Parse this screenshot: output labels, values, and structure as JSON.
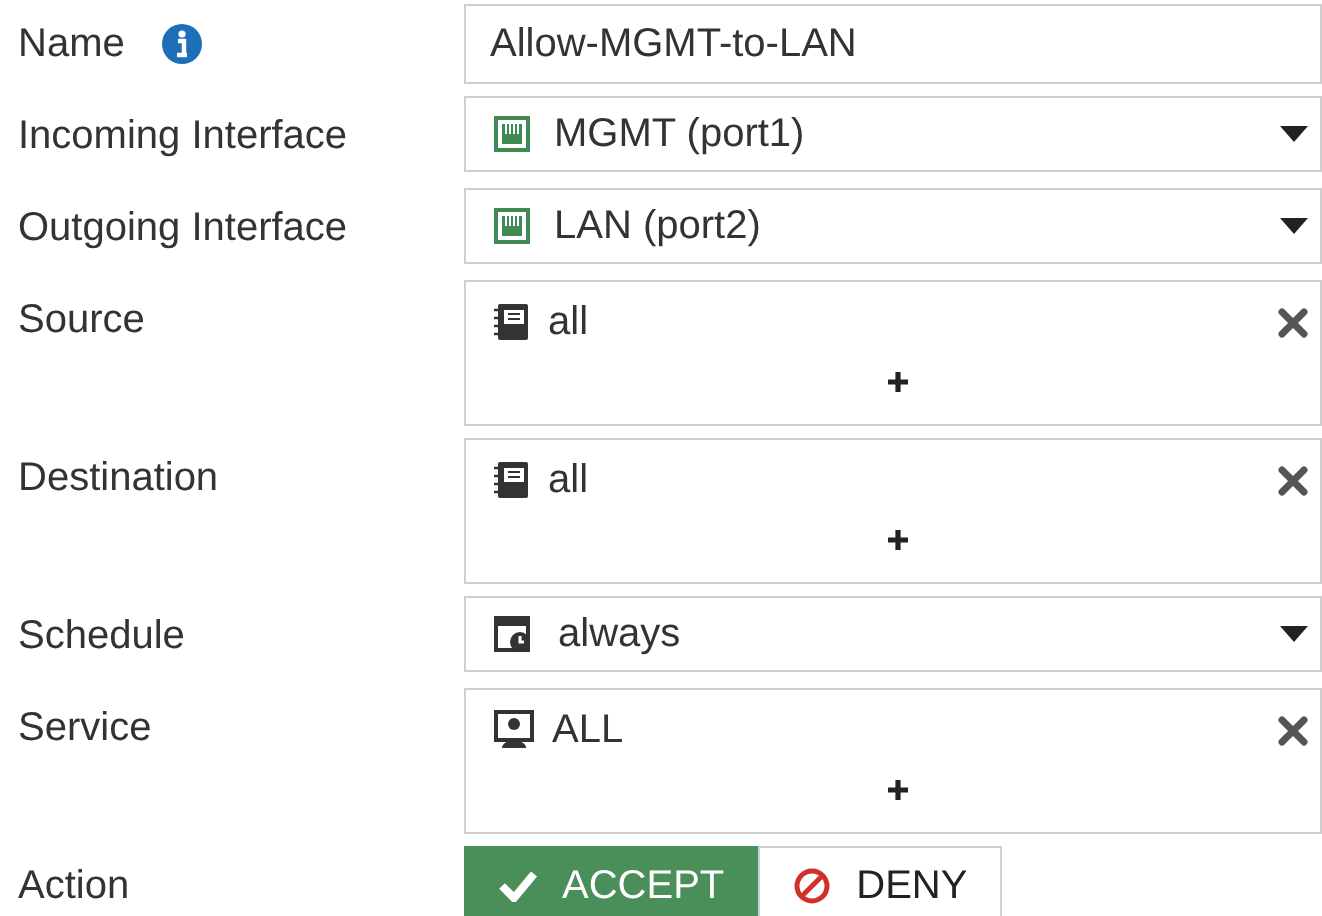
{
  "fields": [
    {
      "kind": "text",
      "label": "Name",
      "value": "Allow-MGMT-to-LAN"
    },
    {
      "kind": "select",
      "label": "Incoming Interface",
      "value": "MGMT (port1)"
    },
    {
      "kind": "select",
      "label": "Outgoing Interface",
      "value": "LAN (port2)"
    },
    {
      "kind": "multi",
      "label": "Source",
      "value": "all"
    },
    {
      "kind": "multi",
      "label": "Destination",
      "value": "all"
    },
    {
      "kind": "select",
      "label": "Schedule",
      "value": "always"
    },
    {
      "kind": "multi",
      "label": "Service",
      "value": "ALL"
    },
    {
      "kind": "action",
      "label": "Action",
      "options": [
        {
          "label": "ACCEPT",
          "kind": "accept",
          "selected": true
        },
        {
          "label": "DENY",
          "kind": "deny",
          "selected": false
        }
      ]
    }
  ]
}
